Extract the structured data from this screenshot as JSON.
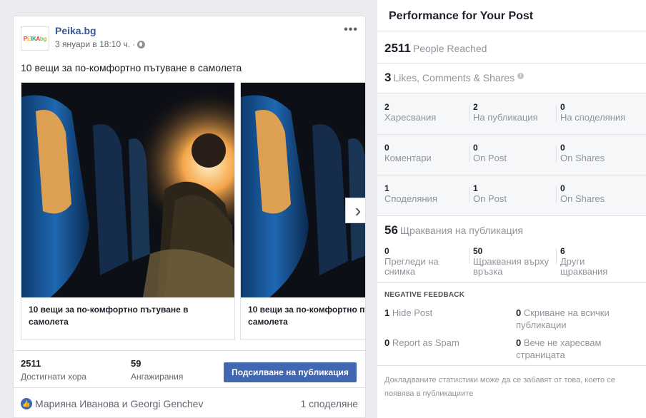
{
  "post": {
    "page_name": "Peika.bg",
    "avatar_text": "PEIKAbg",
    "timestamp": "3 януари в 18:10 ч. ·",
    "more_label": "•••",
    "text": "10 вещи за по-комфортно пътуване в самолета",
    "carousel": [
      {
        "title": "10 вещи за по-комфортно пътуване в самолета"
      },
      {
        "title": "10 вещи за по-комфортно пътуване в самолета"
      }
    ],
    "next_icon": "›",
    "reached": {
      "value": "2511",
      "label": "Достигнати хора"
    },
    "engagements": {
      "value": "59",
      "label": "Ангажирания"
    },
    "boost_label": "Подсилване на публикация",
    "reactors": "Марияна Иванова и Georgi Genchev",
    "shares": "1 споделяне",
    "accent_color": "#4267b2"
  },
  "performance": {
    "title": "Performance for Your Post",
    "reach": {
      "value": "2511",
      "label": "People Reached"
    },
    "lcs": {
      "value": "3",
      "label": "Likes, Comments & Shares"
    },
    "rows": [
      [
        {
          "n": "2",
          "l": "Харесвания"
        },
        {
          "n": "2",
          "l": "На публикация"
        },
        {
          "n": "0",
          "l": "На споделяния"
        }
      ],
      [
        {
          "n": "0",
          "l": "Коментари"
        },
        {
          "n": "0",
          "l": "On Post"
        },
        {
          "n": "0",
          "l": "On Shares"
        }
      ],
      [
        {
          "n": "1",
          "l": "Споделяния"
        },
        {
          "n": "1",
          "l": "On Post"
        },
        {
          "n": "0",
          "l": "On Shares"
        }
      ]
    ],
    "clicks": {
      "value": "56",
      "label": "Щраквания на публикация"
    },
    "click_rows": [
      {
        "n": "0",
        "l": "Прегледи на снимка"
      },
      {
        "n": "50",
        "l": "Щраквания върху връзка"
      },
      {
        "n": "6",
        "l": "Други щраквания"
      }
    ],
    "negative_title": "NEGATIVE FEEDBACK",
    "negative": [
      {
        "n": "1",
        "l": "Hide Post"
      },
      {
        "n": "0",
        "l": "Скриване на всички публикации"
      },
      {
        "n": "0",
        "l": "Report as Spam"
      },
      {
        "n": "0",
        "l": "Вече не харесвам страницата"
      }
    ],
    "footnote": "Докладваните статистики може да се забавят от това, което се появява в публикациите"
  }
}
